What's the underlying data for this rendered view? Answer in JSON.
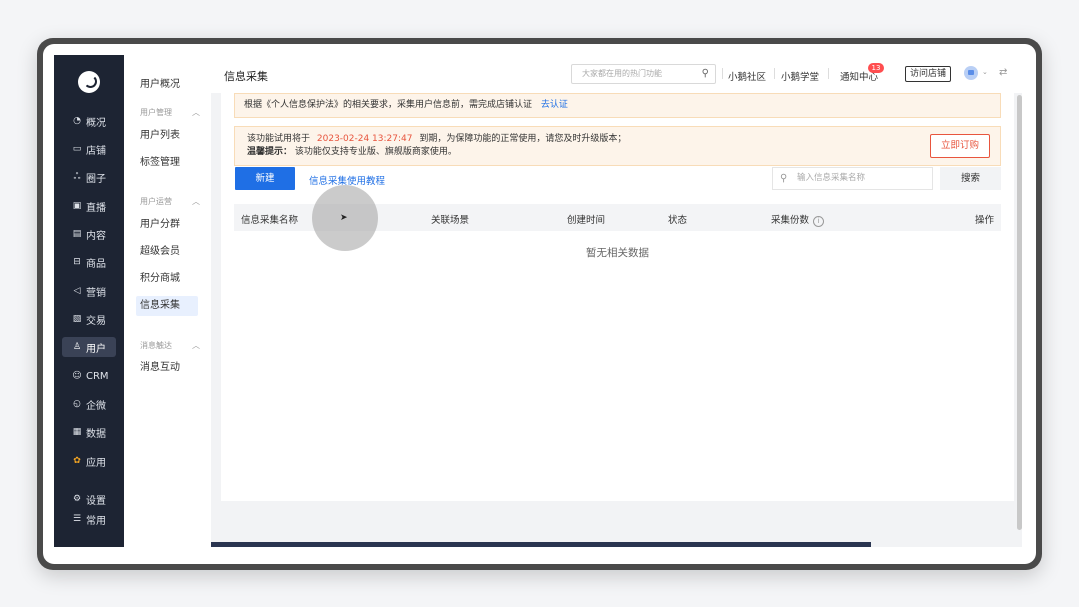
{
  "rail": {
    "items": [
      {
        "label": "概况",
        "icon": "pie-icon"
      },
      {
        "label": "店铺",
        "icon": "store-icon"
      },
      {
        "label": "圈子",
        "icon": "group-icon"
      },
      {
        "label": "直播",
        "icon": "live-icon"
      },
      {
        "label": "内容",
        "icon": "content-icon"
      },
      {
        "label": "商品",
        "icon": "goods-icon"
      },
      {
        "label": "营销",
        "icon": "megaphone-icon"
      },
      {
        "label": "交易",
        "icon": "trade-icon"
      },
      {
        "label": "用户",
        "icon": "user-icon"
      },
      {
        "label": "CRM",
        "icon": "crm-icon"
      },
      {
        "label": "企微",
        "icon": "wecom-icon"
      },
      {
        "label": "数据",
        "icon": "data-icon"
      },
      {
        "label": "应用",
        "icon": "apps-icon"
      },
      {
        "label": "设置",
        "icon": "gear-icon"
      },
      {
        "label": "常用",
        "icon": "menu-icon"
      }
    ]
  },
  "subnav": {
    "top_item": "用户概况",
    "group1": "用户管理",
    "group1_items": [
      "用户列表",
      "标签管理"
    ],
    "group2": "用户运营",
    "group2_items": [
      "用户分群",
      "超级会员",
      "积分商城",
      "信息采集"
    ],
    "group3": "消息触达",
    "group3_items": [
      "消息互动"
    ]
  },
  "topbar": {
    "title": "信息采集",
    "search_placeholder": "大家都在用的热门功能",
    "community": "小鹅社区",
    "academy": "小鹅学堂",
    "notifications": "通知中心",
    "notification_count": "13",
    "visit_store": "访问店铺"
  },
  "notice1": {
    "text": "根据《个人信息保护法》的相关要求，采集用户信息前，需完成店铺认证",
    "link": "去认证"
  },
  "notice2": {
    "line1_prefix": "该功能试用将于",
    "expire_date": "2023-02-24 13:27:47",
    "line1_suffix": "到期，为保障功能的正常使用，请您及时升级版本；",
    "tip_label": "温馨提示：",
    "tip_text": "该功能仅支持专业版、旗舰版商家使用。",
    "buy_button": "立即订购"
  },
  "toolbar": {
    "new_button": "新建",
    "tutorial_link": "信息采集使用教程",
    "filter_placeholder": "输入信息采集名称",
    "search_button": "搜索"
  },
  "table": {
    "columns": [
      "信息采集名称",
      "关联场景",
      "创建时间",
      "状态",
      "采集份数",
      "操作"
    ],
    "info_glyph": "i",
    "empty_text": "暂无相关数据"
  }
}
